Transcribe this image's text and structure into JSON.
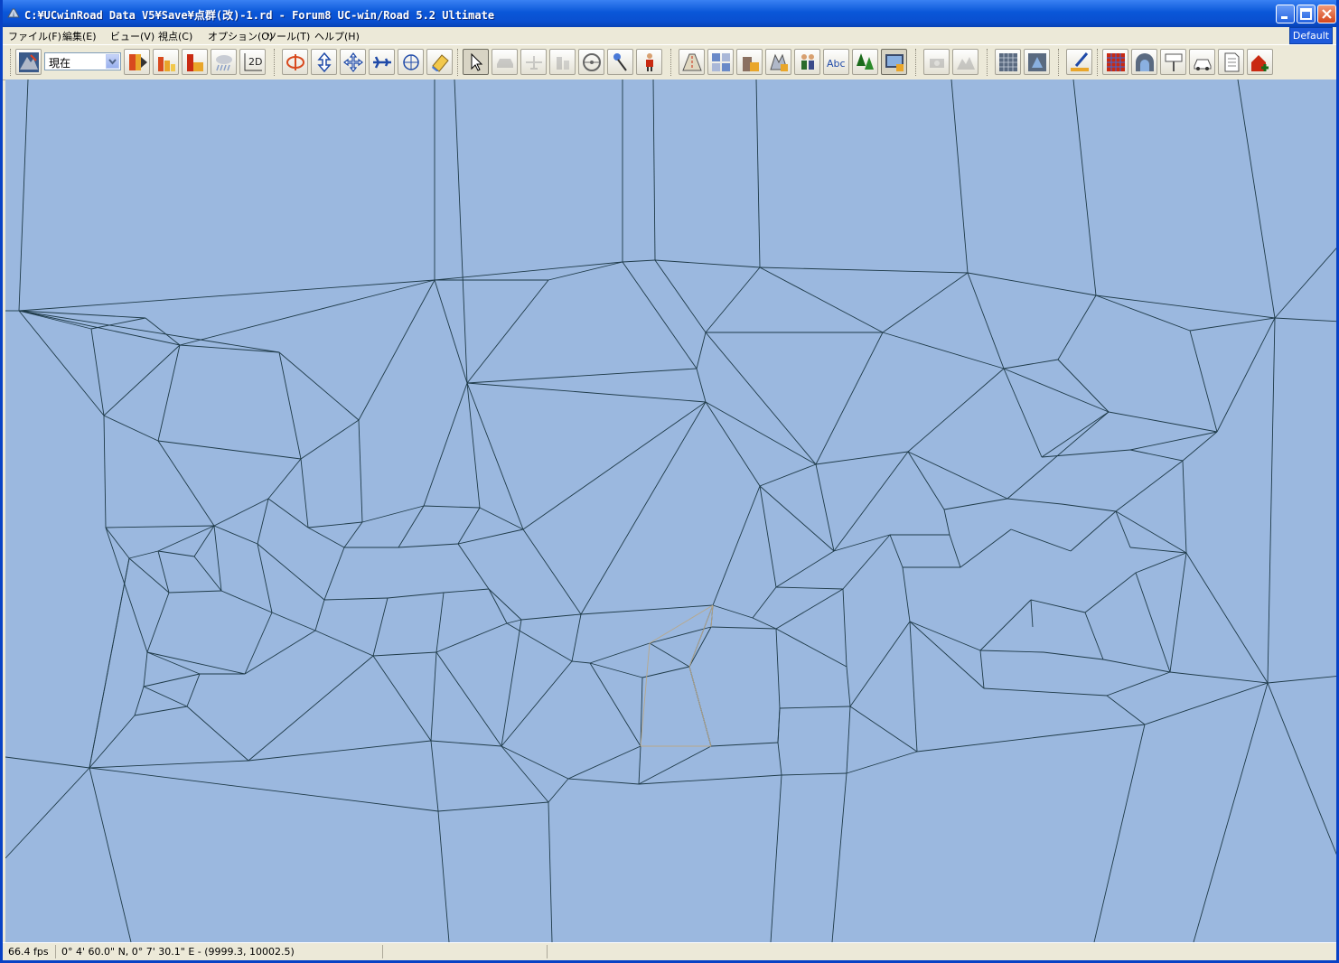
{
  "window": {
    "title": "C:¥UCwinRoad Data V5¥Save¥点群(改)-1.rd - Forum8 UC-win/Road 5.2 Ultimate",
    "colors": {
      "titlebar": "#0a57d8",
      "viewport_background": "#9bb8df",
      "mesh_line": "#1e3a48"
    }
  },
  "menu": {
    "items": [
      "ファイル(F)",
      "編集(E)",
      "ビュー(V)",
      "視点(C)",
      "オプション(O)",
      "ツール(T)",
      "ヘルプ(H)"
    ]
  },
  "default_button": "Default",
  "toolbar": {
    "time_select": {
      "value": "現在"
    },
    "two_d_label": "2D",
    "text_tool_label": "Abc",
    "icons": [
      "terrain-icon",
      "play-icon",
      "bar-chart-icon",
      "bar-chart-red-icon",
      "weather-icon",
      "2d-view-icon",
      "rotate-icon",
      "move-vertical-icon",
      "move-cross-icon",
      "fly-icon",
      "orbit-icon",
      "eraser-icon",
      "pointer-icon",
      "car-view-icon",
      "plane-view-icon",
      "train-view-icon",
      "steering-wheel-icon",
      "pin-icon",
      "person-icon",
      "road-icon",
      "grid-icon",
      "building-icon",
      "model-icon",
      "people-icon",
      "text-icon",
      "trees-icon",
      "screen-icon",
      "camera-icon",
      "terrain-edit-icon",
      "mesh-grid-icon",
      "mesh-edit-icon",
      "brush-icon",
      "grid-color-icon",
      "tunnel-icon",
      "sign-icon",
      "vehicle-icon",
      "document-icon",
      "add-building-icon"
    ]
  },
  "statusbar": {
    "fps": "66.4 fps",
    "coordinates": "0°  4' 60.0\" N, 0°  7' 30.1\" E  -  (9999.3, 10002.5)"
  }
}
